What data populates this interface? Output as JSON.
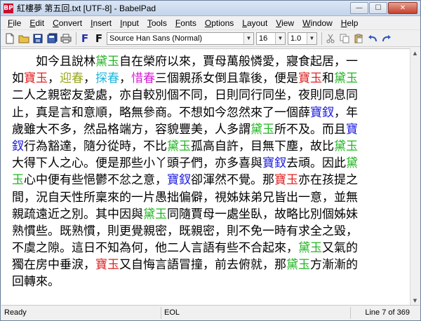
{
  "window": {
    "title": "紅樓夢 第五回.txt [UTF-8] - BabelPad",
    "app_icon_text": "BP",
    "minimize": "—",
    "maximize": "☐",
    "close": "✕"
  },
  "menu": [
    "File",
    "Edit",
    "Convert",
    "Insert",
    "Input",
    "Tools",
    "Fonts",
    "Options",
    "Layout",
    "View",
    "Window",
    "Help"
  ],
  "toolbar": {
    "font_name": "Source Han Sans (Normal)",
    "font_size": "16",
    "line_spacing": "1.0",
    "icons": [
      "new-file-icon",
      "open-folder-icon",
      "save-icon",
      "save-all-icon",
      "print-icon",
      "bold-font-icon",
      "font-icon",
      "cut-icon",
      "copy-icon",
      "paste-icon",
      "undo-icon",
      "redo-icon"
    ]
  },
  "colors": {
    "baoyu": "#e02020",
    "daiyu": "#22b522",
    "baochai": "#2020e0",
    "yingchun": "#9aa51a",
    "tanchun": "#1fb5e0",
    "xichun": "#d61fd6"
  },
  "document": {
    "lines": [
      [
        {
          "t": "　　如今且說林"
        },
        {
          "t": "黛玉",
          "c": "daiyu"
        },
        {
          "t": "自在榮府以來，賈母萬般憐愛，寢食起居，一"
        }
      ],
      [
        {
          "t": "如"
        },
        {
          "t": "寶玉",
          "c": "baoyu"
        },
        {
          "t": "，"
        },
        {
          "t": "迎春",
          "c": "yingchun"
        },
        {
          "t": "，"
        },
        {
          "t": "探春",
          "c": "tanchun"
        },
        {
          "t": "，"
        },
        {
          "t": "惜春",
          "c": "xichun"
        },
        {
          "t": "三個親孫女倒且靠後，便是"
        },
        {
          "t": "寶玉",
          "c": "baoyu"
        },
        {
          "t": "和"
        },
        {
          "t": "黛玉",
          "c": "daiyu"
        }
      ],
      [
        {
          "t": "二人之親密友愛處，亦自較別個不同，日則同行同坐，夜則同息同"
        }
      ],
      [
        {
          "t": "止，真是言和意順，略無參商。不想如今忽然來了一個薛"
        },
        {
          "t": "寶釵",
          "c": "baochai"
        },
        {
          "t": "，年"
        }
      ],
      [
        {
          "t": "歲雖大不多，然品格端方，容貌豐美，人多謂"
        },
        {
          "t": "黛玉",
          "c": "daiyu"
        },
        {
          "t": "所不及。而且"
        },
        {
          "t": "寶",
          "c": "baochai"
        }
      ],
      [
        {
          "t": "釵",
          "c": "baochai"
        },
        {
          "t": "行為豁達，隨分從時，不比"
        },
        {
          "t": "黛玉",
          "c": "daiyu"
        },
        {
          "t": "孤高自許，目無下塵，故比"
        },
        {
          "t": "黛玉",
          "c": "daiyu"
        }
      ],
      [
        {
          "t": "大得下人之心。便是那些小丫頭子們，亦多喜與"
        },
        {
          "t": "寶釵",
          "c": "baochai"
        },
        {
          "t": "去頑。因此"
        },
        {
          "t": "黛",
          "c": "daiyu"
        }
      ],
      [
        {
          "t": "玉",
          "c": "daiyu"
        },
        {
          "t": "心中便有些悒鬱不忿之意，"
        },
        {
          "t": "寶釵",
          "c": "baochai"
        },
        {
          "t": "卻渾然不覺。那"
        },
        {
          "t": "寶玉",
          "c": "baoyu"
        },
        {
          "t": "亦在孩提之"
        }
      ],
      [
        {
          "t": "間，況自天性所稟來的一片愚拙偏僻，視姊妹弟兄皆出一意，並無"
        }
      ],
      [
        {
          "t": "親疏遠近之別。其中因與"
        },
        {
          "t": "黛玉",
          "c": "daiyu"
        },
        {
          "t": "同隨賈母一處坐臥，故略比別個姊妹"
        }
      ],
      [
        {
          "t": "熟慣些。既熟慣，則更覺親密，既親密，則不免一時有求全之毀，"
        }
      ],
      [
        {
          "t": "不虞之隙。這日不知為何，他二人言語有些不合起來，"
        },
        {
          "t": "黛玉",
          "c": "daiyu"
        },
        {
          "t": "又氣的"
        }
      ],
      [
        {
          "t": "獨在房中垂淚，"
        },
        {
          "t": "寶玉",
          "c": "baoyu"
        },
        {
          "t": "又自悔言語冒撞，前去俯就，那"
        },
        {
          "t": "黛玉",
          "c": "daiyu"
        },
        {
          "t": "方漸漸的"
        }
      ],
      [
        {
          "t": "回轉來。"
        }
      ]
    ]
  },
  "status": {
    "ready": "Ready",
    "eol": "EOL",
    "line": "Line 7 of 369"
  }
}
